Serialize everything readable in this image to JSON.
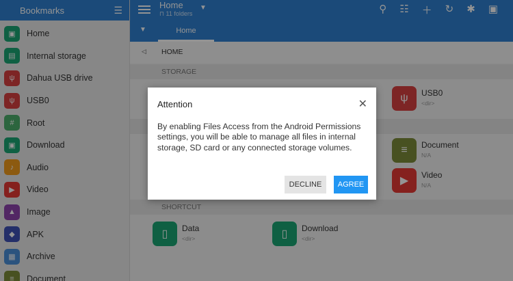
{
  "sidebar": {
    "title": "Bookmarks",
    "items": [
      {
        "label": "Home",
        "icon": "home-icon",
        "color": "#1aa574",
        "glyph": "▣"
      },
      {
        "label": "Internal storage",
        "icon": "storage-icon",
        "color": "#1aa574",
        "glyph": "▤"
      },
      {
        "label": "Dahua USB drive",
        "icon": "usb-icon",
        "color": "#d84040",
        "glyph": "ψ"
      },
      {
        "label": "USB0",
        "icon": "usb-icon",
        "color": "#d84040",
        "glyph": "ψ"
      },
      {
        "label": "Root",
        "icon": "hash-icon",
        "color": "#4caf6b",
        "glyph": "#"
      },
      {
        "label": "Download",
        "icon": "download-icon",
        "color": "#1aa574",
        "glyph": "▣"
      },
      {
        "label": "Audio",
        "icon": "audio-icon",
        "color": "#f29b1c",
        "glyph": "♪"
      },
      {
        "label": "Video",
        "icon": "video-icon",
        "color": "#e53935",
        "glyph": "▶"
      },
      {
        "label": "Image",
        "icon": "image-icon",
        "color": "#8e44ad",
        "glyph": "▲"
      },
      {
        "label": "APK",
        "icon": "android-icon",
        "color": "#3f51b5",
        "glyph": "◆"
      },
      {
        "label": "Archive",
        "icon": "archive-icon",
        "color": "#4a90d9",
        "glyph": "▦"
      },
      {
        "label": "Document",
        "icon": "document-icon",
        "color": "#7c8c3a",
        "glyph": "≡"
      }
    ]
  },
  "topbar": {
    "title": "Home",
    "subtitle": "11 folders"
  },
  "tabs": [
    {
      "label": "Home"
    }
  ],
  "breadcrumb": {
    "path": "HOME"
  },
  "sections": {
    "storage": "STORAGE",
    "shortcut": "SHORTCUT"
  },
  "files": {
    "usb0": {
      "name": "USB0",
      "sub": "<dir>",
      "color": "#d84040"
    },
    "document": {
      "name": "Document",
      "sub": "N/A",
      "color": "#7c8c3a"
    },
    "video": {
      "name": "Video",
      "sub": "N/A",
      "color": "#e53935"
    },
    "data": {
      "name": "Data",
      "sub": "<dir>",
      "color": "#1aa574"
    },
    "download": {
      "name": "Download",
      "sub": "<dir>",
      "color": "#1aa574"
    }
  },
  "dialog": {
    "title": "Attention",
    "body": "By enabling Files Access from the Android Permissions settings, you will be able to manage all files in internal storage, SD card or any connected storage volumes.",
    "decline": "DECLINE",
    "agree": "AGREE"
  },
  "colors": {
    "primary": "#2f80d0",
    "accent": "#2196f3"
  }
}
